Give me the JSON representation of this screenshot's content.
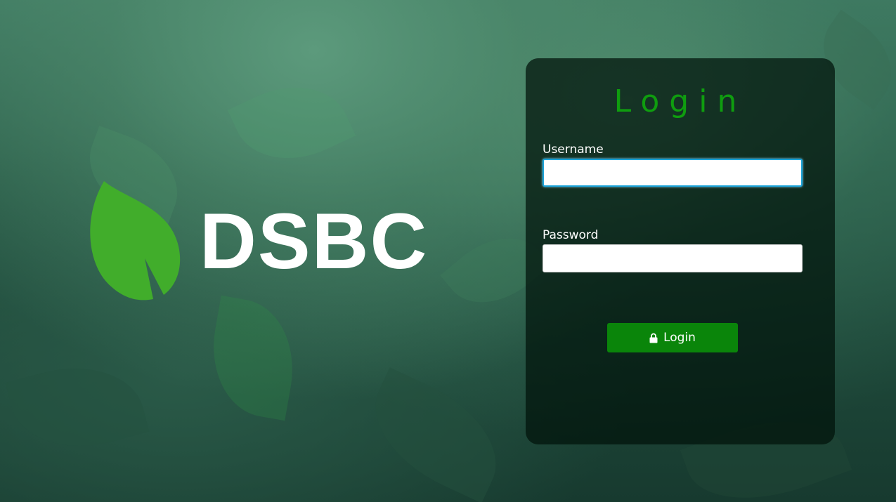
{
  "brand": {
    "name": "DSBC",
    "leaf_color": "#41ad2b",
    "logo_icon": "leaf-icon"
  },
  "login": {
    "title": "Login",
    "title_color": "#0f9d0f",
    "username_label": "Username",
    "username_value": "",
    "password_label": "Password",
    "password_value": "",
    "button_label": "Login",
    "button_icon": "lock-icon",
    "button_color": "#0a850a"
  }
}
